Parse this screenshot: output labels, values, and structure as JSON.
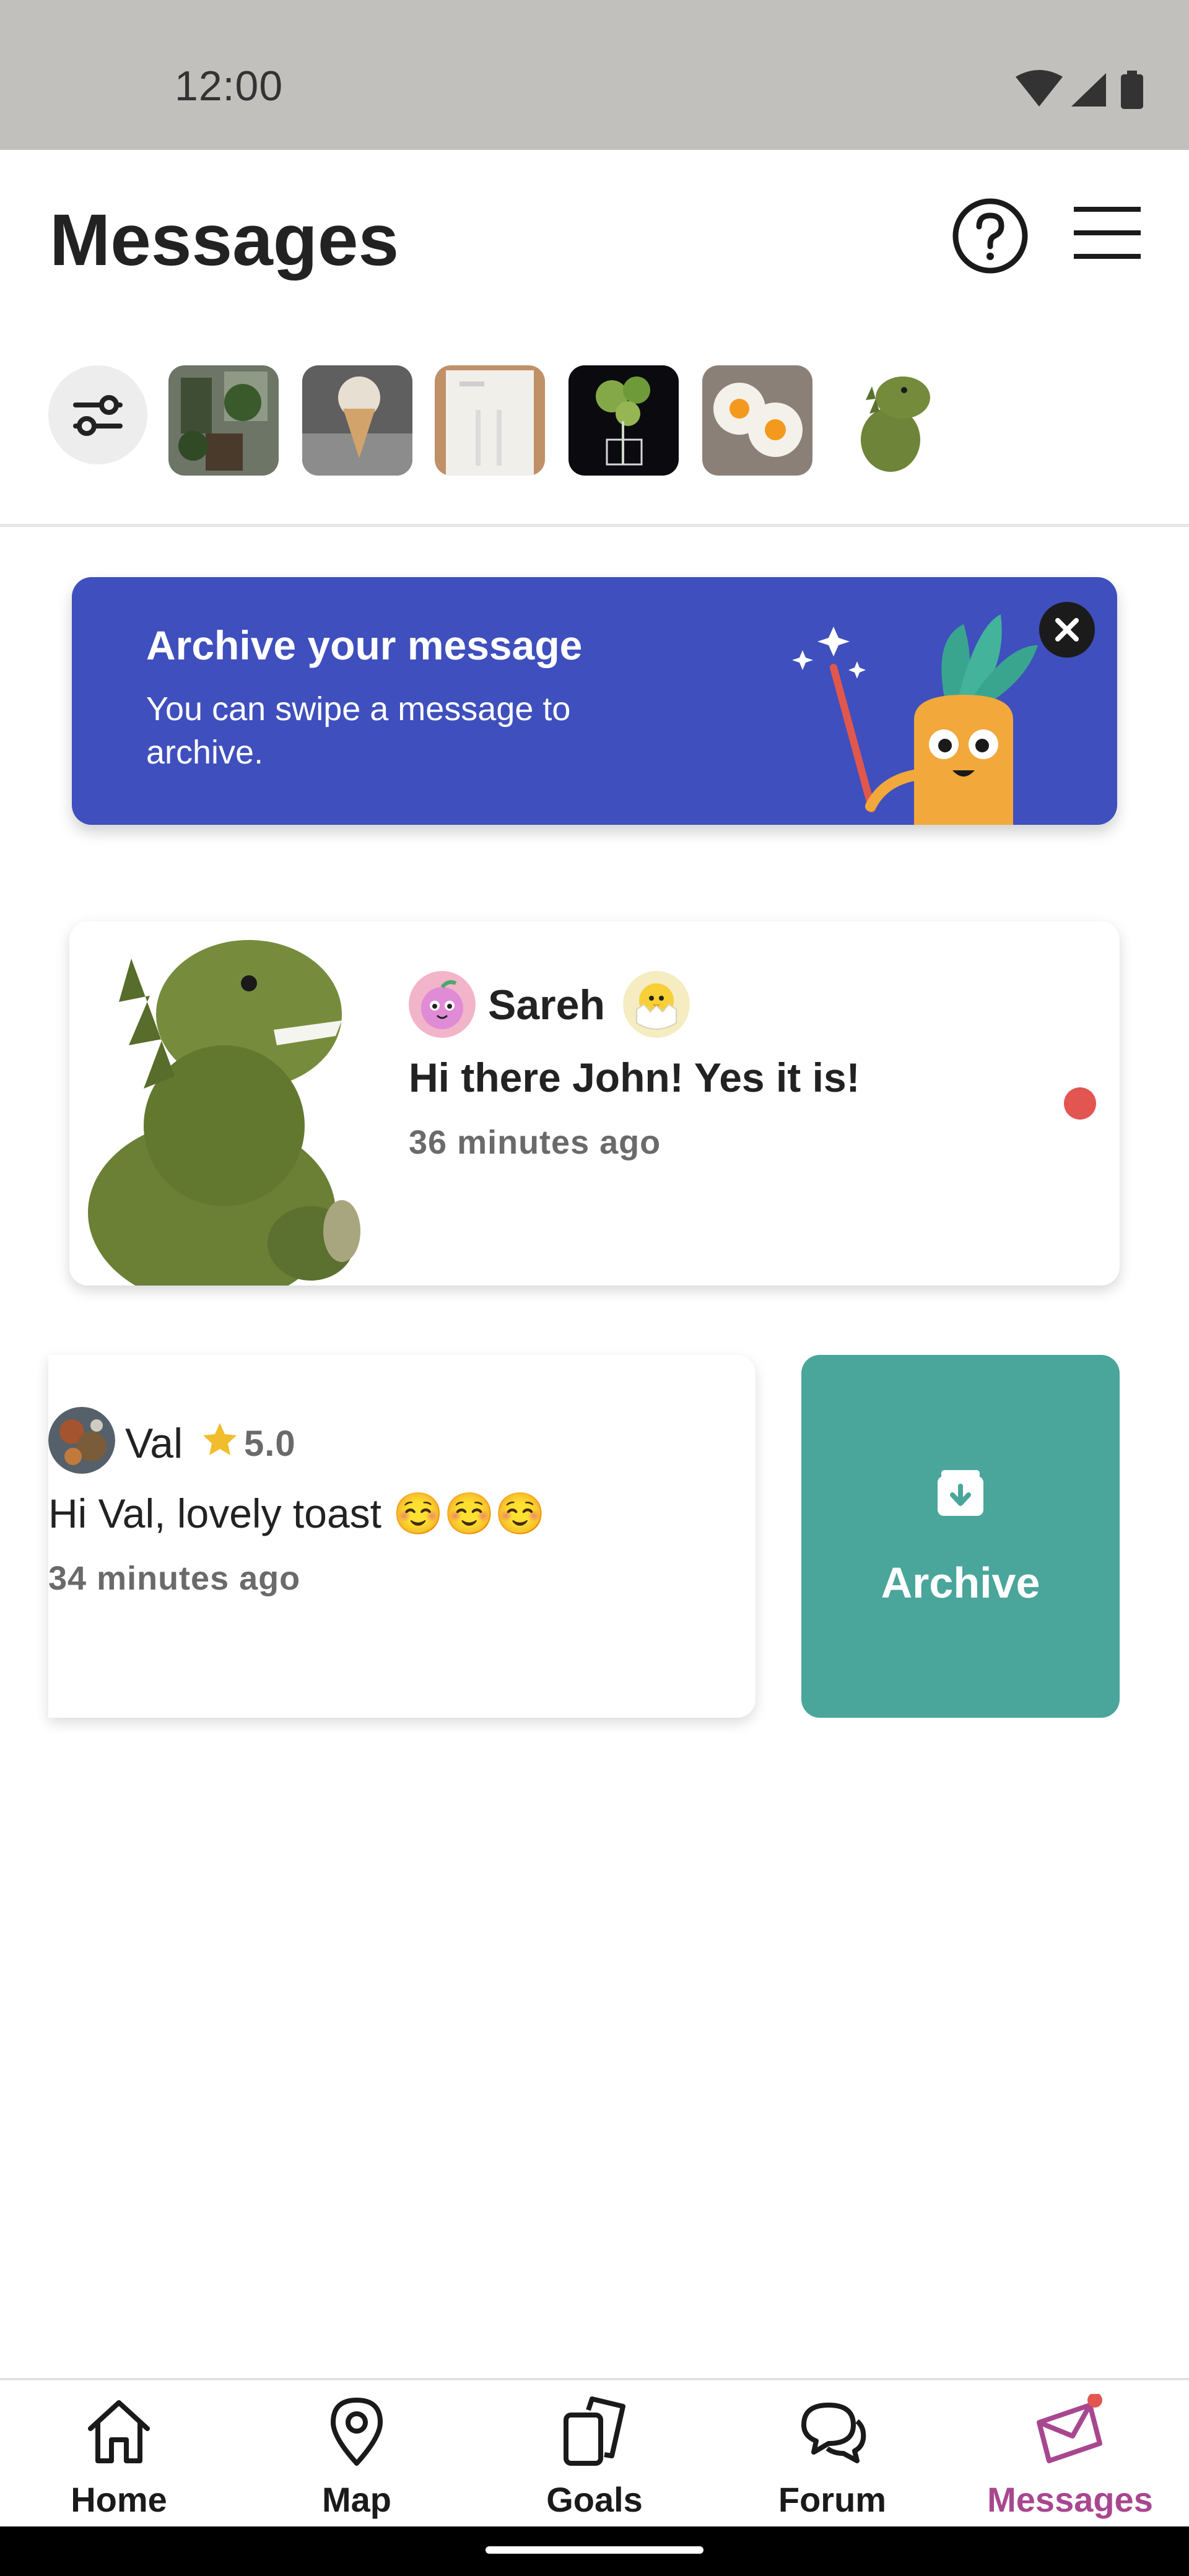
{
  "status_bar": {
    "time": "12:00"
  },
  "header": {
    "title": "Messages"
  },
  "filters": {
    "thumbnails": [
      "plant-shop",
      "ice-cream",
      "cables-box",
      "herb-plant",
      "fried-eggs",
      "dino-plush"
    ]
  },
  "banner": {
    "title": "Archive your message",
    "text": "You can swipe a message to archive."
  },
  "conversations": [
    {
      "name": "Sareh",
      "message": "Hi there John! Yes it is!",
      "time": "36 minutes ago",
      "unread": true
    },
    {
      "name": "Val",
      "rating": "5.0",
      "message": "Hi Val, lovely toast ☺️☺️☺️",
      "time": "34 minutes ago"
    }
  ],
  "swipe_action": {
    "label": "Archive"
  },
  "bottom_nav": {
    "items": [
      {
        "label": "Home",
        "icon": "home-icon"
      },
      {
        "label": "Map",
        "icon": "map-pin-icon"
      },
      {
        "label": "Goals",
        "icon": "goals-icon"
      },
      {
        "label": "Forum",
        "icon": "forum-icon"
      },
      {
        "label": "Messages",
        "icon": "messages-icon",
        "active": true
      }
    ]
  },
  "colors": {
    "banner_bg": "#3f4fbd",
    "archive_bg": "#4aa59b",
    "active_nav": "#a8478f",
    "unread_dot": "#e25550"
  }
}
